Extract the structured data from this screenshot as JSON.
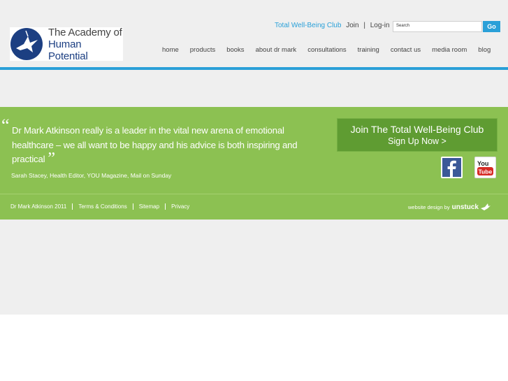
{
  "header": {
    "logo": {
      "line1": "The Academy of",
      "line2": "Human Potential"
    },
    "toplinks": {
      "club": "Total Well-Being Club",
      "join": "Join",
      "separator": "|",
      "login": "Log-in"
    },
    "search": {
      "value": "Search",
      "button": "Go"
    },
    "nav": [
      "home",
      "products",
      "books",
      "about dr mark",
      "consultations",
      "training",
      "contact us",
      "media room",
      "blog"
    ]
  },
  "testimonial": {
    "quote": "Dr Mark Atkinson really is a leader in the vital new arena of emotional healthcare – we all want to be happy and his advice is both inspiring and practical",
    "open_mark": "“",
    "close_mark": "”",
    "attribution": "Sarah Stacey, Health Editor, YOU Magazine, Mail on Sunday"
  },
  "club_box": {
    "title": "Join The Total Well-Being Club",
    "cta": "Sign Up Now >"
  },
  "social": {
    "facebook": "facebook-icon",
    "youtube": "youtube-icon"
  },
  "footer": {
    "links": [
      "Dr Mark Atkinson 2011",
      "Terms & Conditions",
      "Sitemap",
      "Privacy"
    ],
    "credit_prefix": "website design by",
    "credit_brand": "unstuck"
  },
  "colors": {
    "blue": "#2aa0d8",
    "green": "#8cc152",
    "dark_green": "#5f9c32",
    "navy": "#1c3f82"
  }
}
